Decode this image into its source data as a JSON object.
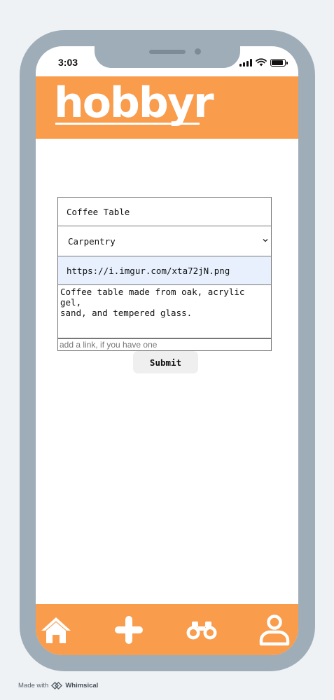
{
  "status_bar": {
    "time": "3:03"
  },
  "header": {
    "logo_text": "hobbyr"
  },
  "form": {
    "title_value": "Coffee Table",
    "category_selected": "Carpentry",
    "image_url_value": "https://i.imgur.com/xta72jN.png",
    "description_value": "Coffee table made from oak, acrylic gel,\nsand, and tempered glass.",
    "link_placeholder": "add a link, if you have one",
    "submit_label": "Submit"
  },
  "bottom_nav": {
    "items": [
      {
        "icon": "home-icon"
      },
      {
        "icon": "plus-icon"
      },
      {
        "icon": "binoculars-icon"
      },
      {
        "icon": "user-icon"
      }
    ]
  },
  "footer": {
    "made_with": "Made with",
    "brand": "Whimsical"
  },
  "colors": {
    "accent": "#f99c4c",
    "frame": "#9eadb8",
    "background": "#eff2f5",
    "autofill": "#e8f0fe"
  }
}
